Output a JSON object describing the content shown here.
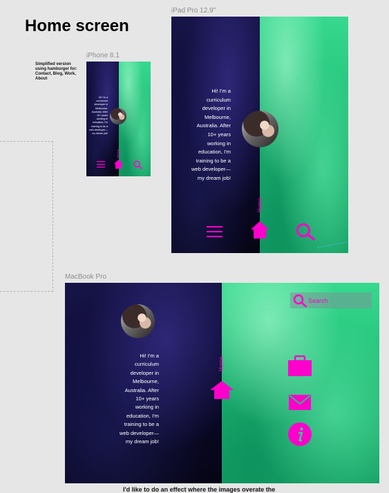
{
  "page": {
    "title": "Home screen"
  },
  "connector": {
    "caption": "I'd like to do an effect where the images overate the"
  },
  "iphone": {
    "frame_label": "iPhone 8.1",
    "note": "Simplified version using hamburger for: Contact, Blog, Work, About",
    "intro": "Hi! I'm a curriculum developer in Melbourne, Australia. After 10+ years working in education, I'm training to be a web developer—my dream job!",
    "home_label": "Home"
  },
  "ipad": {
    "frame_label": "iPad Pro 12.9\"",
    "intro": "Hi! I'm a curriculum developer in Melbourne, Australia. After 10+ years working in education, I'm training to be a web developer—my dream job!",
    "home_label": "Home"
  },
  "macbook": {
    "frame_label": "MacBook Pro",
    "intro": "Hi! I'm a curriculum developer in Melbourne, Australia. After 10+ years working in education, I'm training to be a web developer—my dream job!",
    "home_label": "Home",
    "search": {
      "placeholder": "Search"
    },
    "nav_icons": [
      "briefcase-icon",
      "mail-icon",
      "info-icon"
    ]
  },
  "colors": {
    "accent": "#ff00cc",
    "dark_panel": "#0d0b33",
    "green_panel": "#22c27b",
    "canvas": "#e6e6e6"
  }
}
